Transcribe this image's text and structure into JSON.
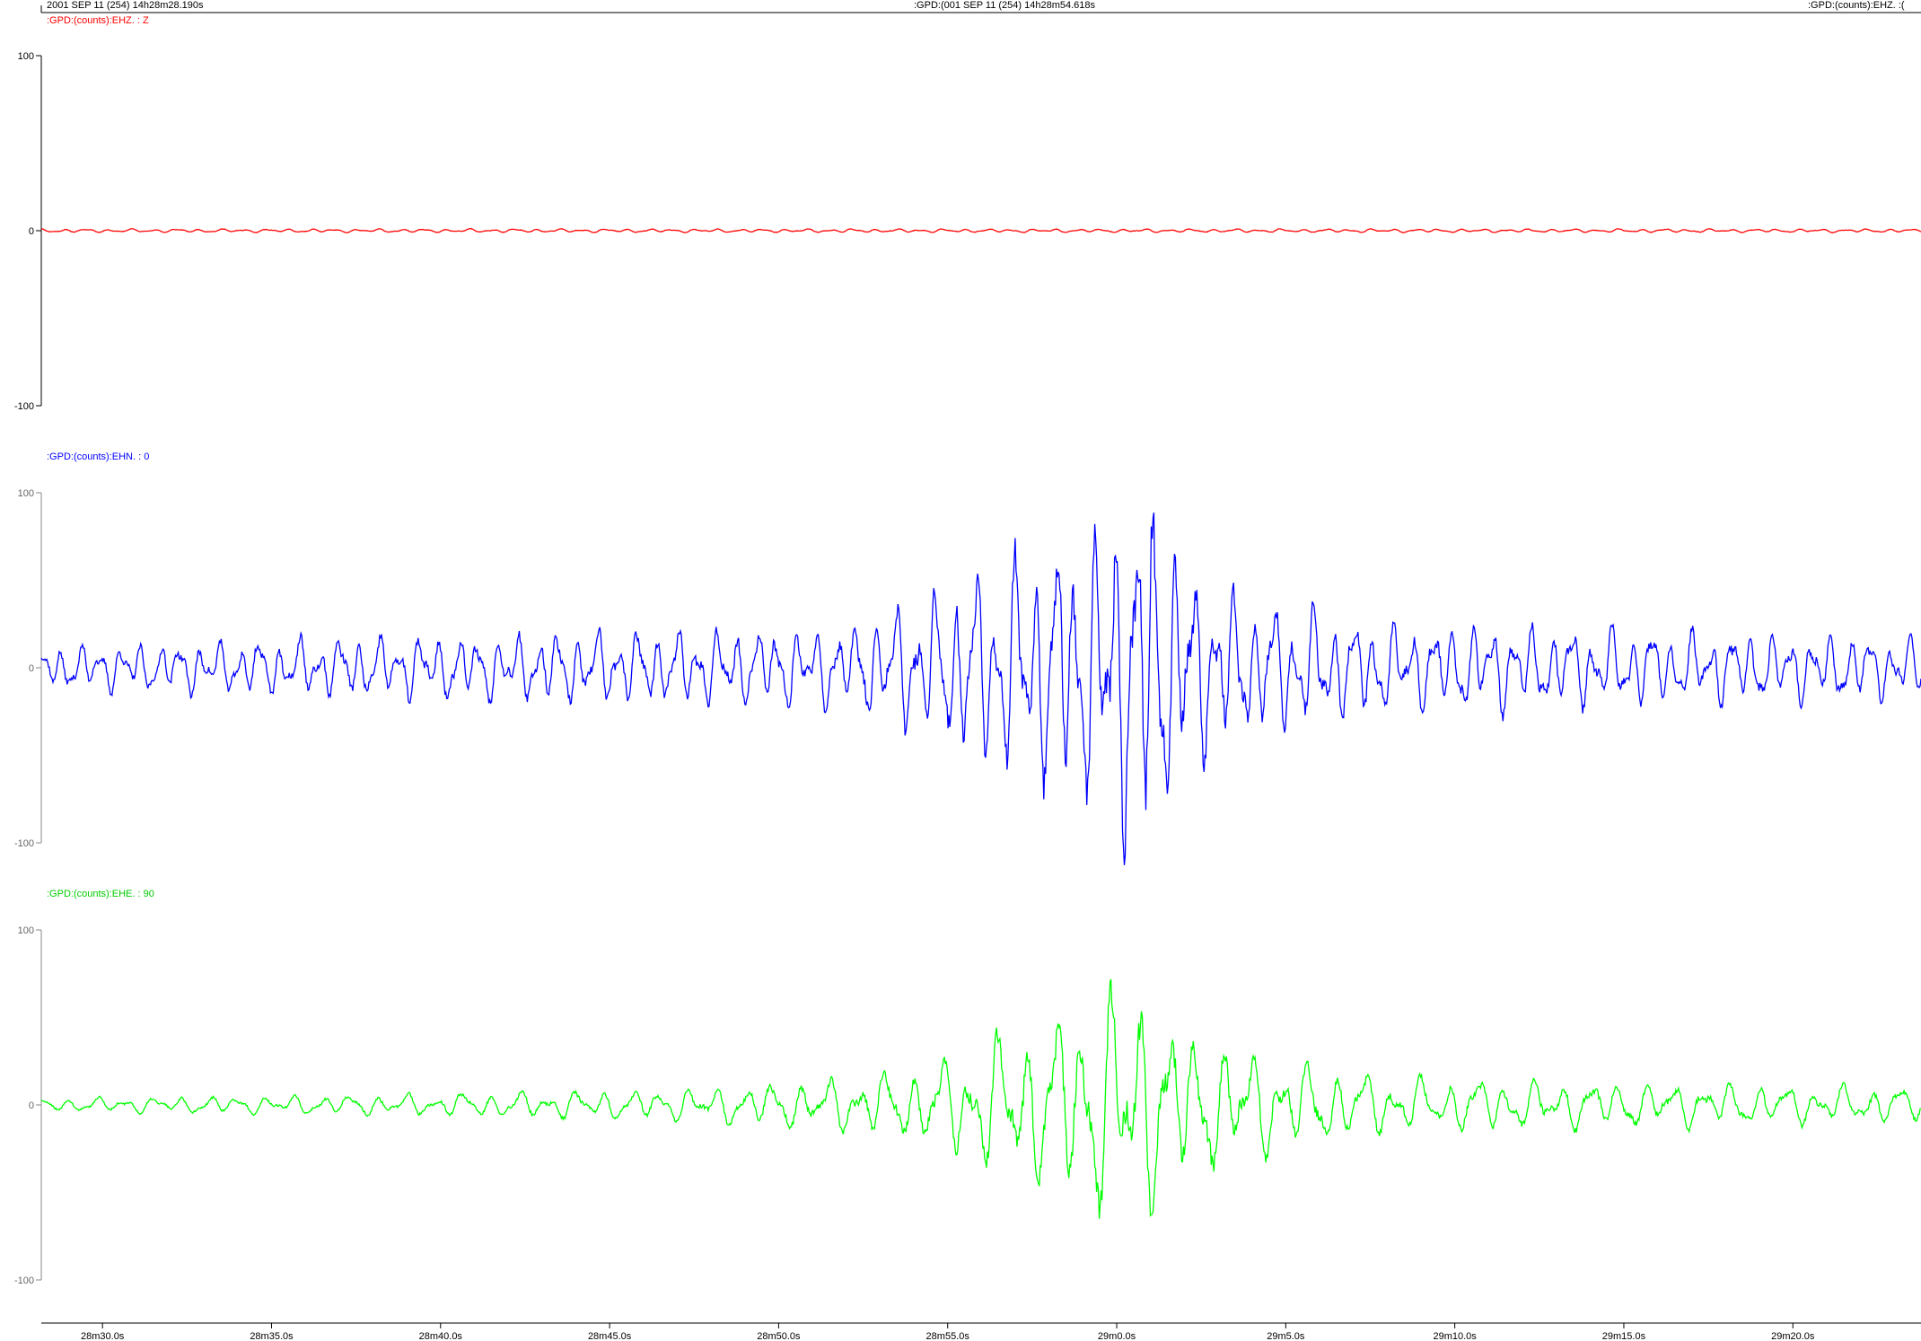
{
  "header": {
    "left": "2001 SEP 11 (254)  14h28m28.190s",
    "center": ":GPD:(001 SEP 11 (254)  14h28m54.618s",
    "right": ":GPD:(counts):EHZ. :("
  },
  "chart_data": {
    "type": "line",
    "x_unit": "seconds since 14h28m28.190s",
    "xlim": [
      0,
      55.6
    ],
    "x_tick_labels": [
      "28m30.0s",
      "28m35.0s",
      "28m40.0s",
      "28m45.0s",
      "28m50.0s",
      "28m55.0s",
      "29m0.0s",
      "29m5.0s",
      "29m10.0s",
      "29m15.0s",
      "29m20.0s"
    ],
    "panels": [
      {
        "label": ":GPD:(counts):EHZ.  : Z",
        "color": "#ff0000",
        "ylim": [
          -100,
          100
        ],
        "y_ticks": [
          100,
          0,
          -100
        ],
        "y_tick_labels": [
          "100",
          "0",
          "-100"
        ],
        "envelope": {
          "t": [
            0,
            55.6
          ],
          "amp": [
            1,
            1
          ]
        },
        "freq_hz": 1.5,
        "seed": 11
      },
      {
        "label": ":GPD:(counts):EHN.  : 0",
        "color": "#0000ff",
        "ylim": [
          -100,
          100
        ],
        "y_ticks": [
          100,
          0,
          -100
        ],
        "y_tick_labels": [
          "100",
          "0",
          "-100"
        ],
        "envelope": {
          "t": [
            0,
            10,
            20,
            24,
            26,
            29,
            31,
            32.6,
            34,
            36,
            40,
            55.6
          ],
          "amp": [
            12,
            18,
            22,
            24,
            40,
            65,
            80,
            112,
            55,
            38,
            26,
            18
          ]
        },
        "freq_hz": 1.7,
        "seed": 37
      },
      {
        "label": ":GPD:(counts):EHE.  : 90",
        "color": "#00ff00",
        "ylim": [
          -100,
          100
        ],
        "y_ticks": [
          100,
          0,
          -100
        ],
        "y_tick_labels": [
          "100",
          "0",
          "-100"
        ],
        "envelope": {
          "t": [
            0,
            10,
            18,
            23,
            26,
            29,
            31,
            32,
            34,
            37,
            40,
            55.6
          ],
          "amp": [
            4,
            6,
            9,
            14,
            22,
            45,
            60,
            76,
            42,
            25,
            16,
            10
          ]
        },
        "freq_hz": 1.2,
        "seed": 59
      }
    ]
  }
}
